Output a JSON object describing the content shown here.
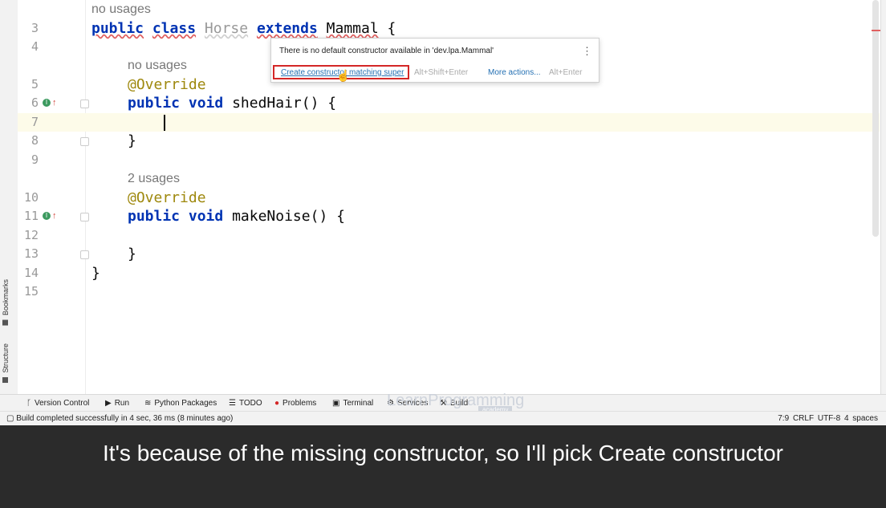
{
  "editor": {
    "line_numbers": [
      "3",
      "4",
      "5",
      "6",
      "7",
      "8",
      "9",
      "10",
      "11",
      "12",
      "13",
      "14",
      "15"
    ],
    "usage_hints": [
      "no usages",
      "no usages",
      "2 usages"
    ],
    "code": {
      "kw_public": "public",
      "kw_class": "class",
      "class_name": "Horse",
      "kw_extends": "extends",
      "super_name": "Mammal",
      "open_brace": "{",
      "annotation": "@Override",
      "kw_void": "void",
      "method1": "shedHair() {",
      "method2": "makeNoise() {",
      "close_brace": "}"
    }
  },
  "popup": {
    "message": "There is no default constructor available in 'dev.lpa.Mammal'",
    "action": "Create constructor matching super",
    "action_shortcut": "Alt+Shift+Enter",
    "more_actions": "More actions...",
    "more_shortcut": "Alt+Enter"
  },
  "side_tabs": [
    "Bookmarks",
    "Structure"
  ],
  "toolbar": [
    "Version Control",
    "Run",
    "Python Packages",
    "TODO",
    "Problems",
    "Terminal",
    "Services",
    "Build"
  ],
  "toolbar_icons": [
    "branch-icon",
    "play-icon",
    "packages-icon",
    "list-icon",
    "error-icon",
    "terminal-icon",
    "services-icon",
    "hammer-icon"
  ],
  "status": {
    "message": "Build completed successfully in 4 sec, 36 ms (8 minutes ago)",
    "position": "7:9",
    "line_ending": "CRLF",
    "encoding": "UTF-8",
    "indent": "4 spaces"
  },
  "watermark": {
    "text": "LearnProgramming",
    "sub": "academy"
  },
  "subtitle": "It's because of the missing constructor, so I'll pick Create constructor",
  "colors": {
    "keyword": "#0033b3",
    "annotation": "#9e880d",
    "highlight_border": "#d42727",
    "link": "#2470b3"
  }
}
